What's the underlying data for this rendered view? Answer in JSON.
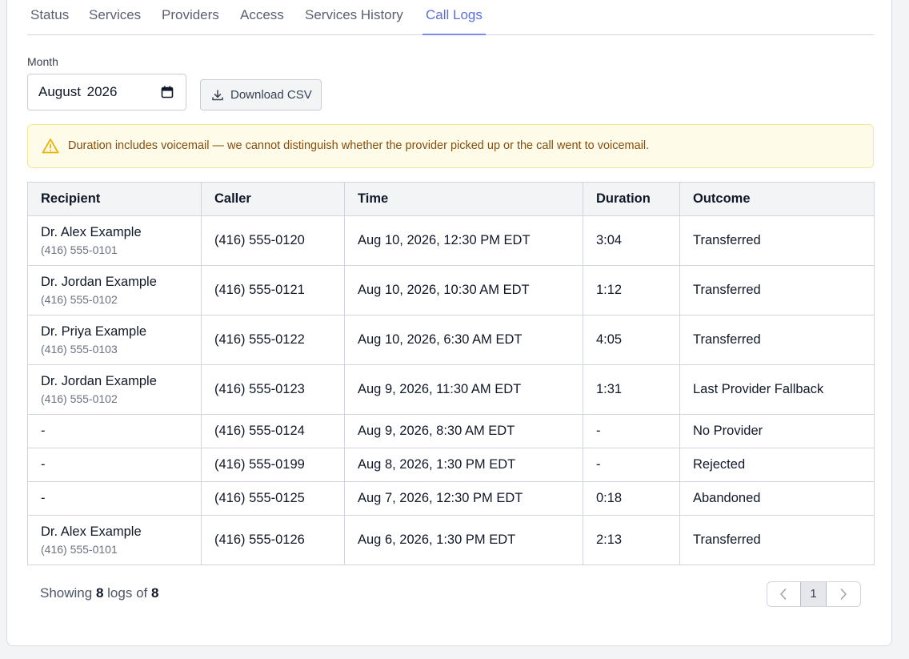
{
  "tabs": [
    {
      "label": "Status"
    },
    {
      "label": "Services"
    },
    {
      "label": "Providers"
    },
    {
      "label": "Access"
    },
    {
      "label": "Services History"
    },
    {
      "label": "Call Logs",
      "active": true
    }
  ],
  "month": {
    "label": "Month",
    "value": "August 2026"
  },
  "download_csv": {
    "label": "Download CSV",
    "icon": "download-icon"
  },
  "alert": {
    "icon": "warning-icon",
    "text": "Duration includes voicemail — we cannot distinguish whether the provider picked up or the call went to voicemail."
  },
  "table": {
    "headers": [
      "Recipient",
      "Caller",
      "Time",
      "Duration",
      "Outcome"
    ],
    "rows": [
      {
        "recipient_name": "Dr. Alex Example",
        "recipient_phone": "(416) 555-0101",
        "caller": "(416) 555-0120",
        "time": "Aug 10, 2026, 12:30 PM EDT",
        "duration": "3:04",
        "outcome": "Transferred"
      },
      {
        "recipient_name": "Dr. Jordan Example",
        "recipient_phone": "(416) 555-0102",
        "caller": "(416) 555-0121",
        "time": "Aug 10, 2026, 10:30 AM EDT",
        "duration": "1:12",
        "outcome": "Transferred"
      },
      {
        "recipient_name": "Dr. Priya Example",
        "recipient_phone": "(416) 555-0103",
        "caller": "(416) 555-0122",
        "time": "Aug 10, 2026, 6:30 AM EDT",
        "duration": "4:05",
        "outcome": "Transferred"
      },
      {
        "recipient_name": "Dr. Jordan Example",
        "recipient_phone": "(416) 555-0102",
        "caller": "(416) 555-0123",
        "time": "Aug 9, 2026, 11:30 AM EDT",
        "duration": "1:31",
        "outcome": "Last Provider Fallback"
      },
      {
        "recipient_name": "-",
        "recipient_phone": "",
        "caller": "(416) 555-0124",
        "time": "Aug 9, 2026, 8:30 AM EDT",
        "duration": "-",
        "outcome": "No Provider"
      },
      {
        "recipient_name": "-",
        "recipient_phone": "",
        "caller": "(416) 555-0199",
        "time": "Aug 8, 2026, 1:30 PM EDT",
        "duration": "-",
        "outcome": "Rejected"
      },
      {
        "recipient_name": "-",
        "recipient_phone": "",
        "caller": "(416) 555-0125",
        "time": "Aug 7, 2026, 12:30 PM EDT",
        "duration": "0:18",
        "outcome": "Abandoned"
      },
      {
        "recipient_name": "Dr. Alex Example",
        "recipient_phone": "(416) 555-0101",
        "caller": "(416) 555-0126",
        "time": "Aug 6, 2026, 1:30 PM EDT",
        "duration": "2:13",
        "outcome": "Transferred"
      }
    ]
  },
  "footer": {
    "prefix": "Showing",
    "shown": "8",
    "middle": "logs of",
    "total": "8"
  },
  "pagination": {
    "current_page": "1"
  },
  "colors": {
    "accent": "#5b6ee1",
    "alert_bg": "#fefce8",
    "alert_text": "#854d0e"
  }
}
